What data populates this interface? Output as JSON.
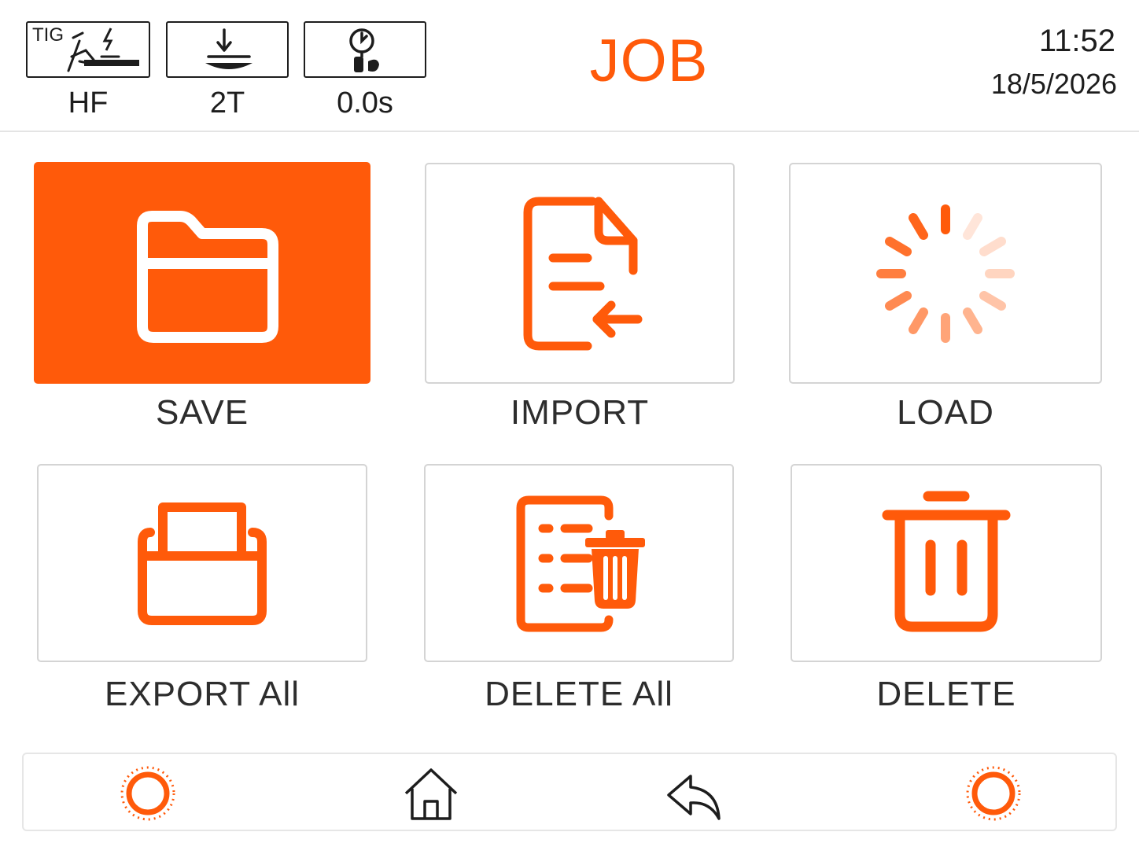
{
  "header": {
    "title": "JOB",
    "time": "11:52",
    "date": "18/5/2026",
    "status": [
      {
        "icon": "tig-torch-icon",
        "box_text": "TIG",
        "label": "HF"
      },
      {
        "icon": "trigger-mode-icon",
        "label": "2T"
      },
      {
        "icon": "gas-timer-icon",
        "label": "0.0s"
      }
    ]
  },
  "actions": [
    {
      "label": "SAVE",
      "icon": "folder-icon",
      "selected": true
    },
    {
      "label": "IMPORT",
      "icon": "file-import-icon",
      "selected": false
    },
    {
      "label": "LOAD",
      "icon": "spinner-icon",
      "selected": false
    },
    {
      "label": "EXPORT All",
      "icon": "export-tray-icon",
      "selected": false
    },
    {
      "label": "DELETE All",
      "icon": "file-delete-icon",
      "selected": false
    },
    {
      "label": "DELETE",
      "icon": "trash-icon",
      "selected": false
    }
  ],
  "nav": [
    {
      "icon": "settings-ring-icon"
    },
    {
      "icon": "home-icon"
    },
    {
      "icon": "back-arrow-icon"
    },
    {
      "icon": "settings-ring-icon"
    }
  ],
  "colors": {
    "accent": "#ff5a0a",
    "text": "#2d2d2d",
    "border": "#d4d4d4"
  }
}
